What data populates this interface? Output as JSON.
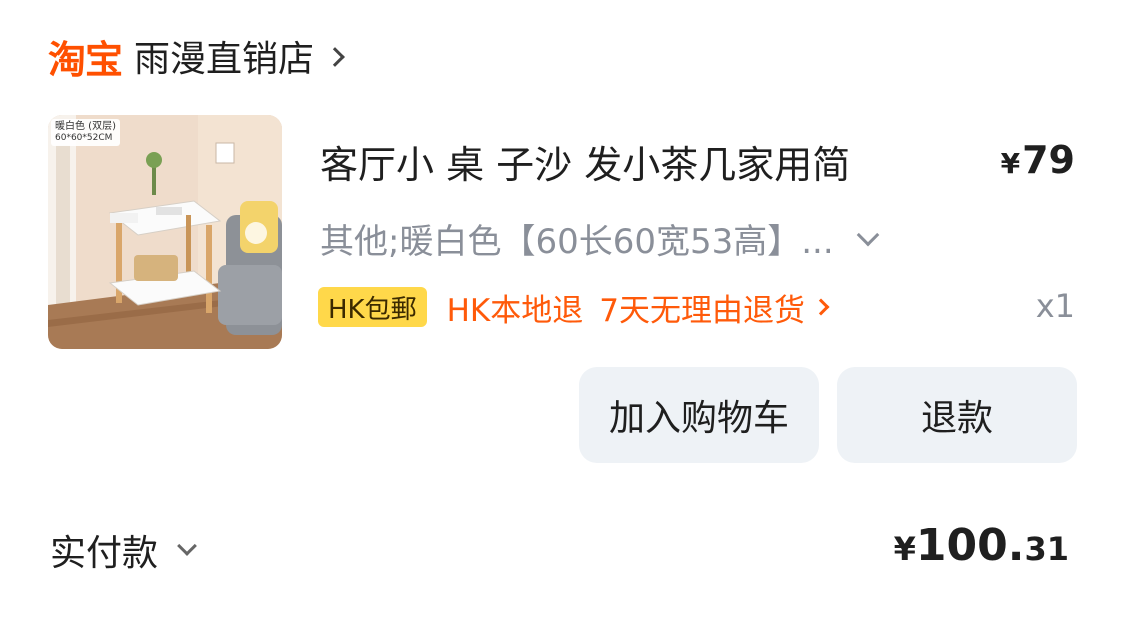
{
  "shop": {
    "logo_text": "淘宝",
    "name": "雨漫直销店"
  },
  "product": {
    "image_tag_line1": "暖白色 (双层)",
    "image_tag_line2": "60*60*52CM",
    "image_label_width": "60CM",
    "image_label_height": "52CM",
    "image_label_depth": "60CM",
    "title": "客厅小 桌 子沙 发小茶几家用简",
    "price_symbol": "¥",
    "price": "79",
    "sku": "其他;暖白色【60长60宽53高】...",
    "quantity": "x1"
  },
  "services": {
    "badge": "HK包郵",
    "local_return": "HK本地退",
    "no_reason_return": "7天无理由退货"
  },
  "actions": {
    "add_to_cart": "加入购物车",
    "refund": "退款"
  },
  "summary": {
    "paid_label": "实付款",
    "total_symbol": "¥",
    "total_int": "100.",
    "total_dec": "31"
  },
  "colors": {
    "brand_orange": "#ff5000",
    "badge_yellow": "#ffd84a",
    "button_bg": "#eef2f6",
    "muted_text": "#8a8f99"
  }
}
